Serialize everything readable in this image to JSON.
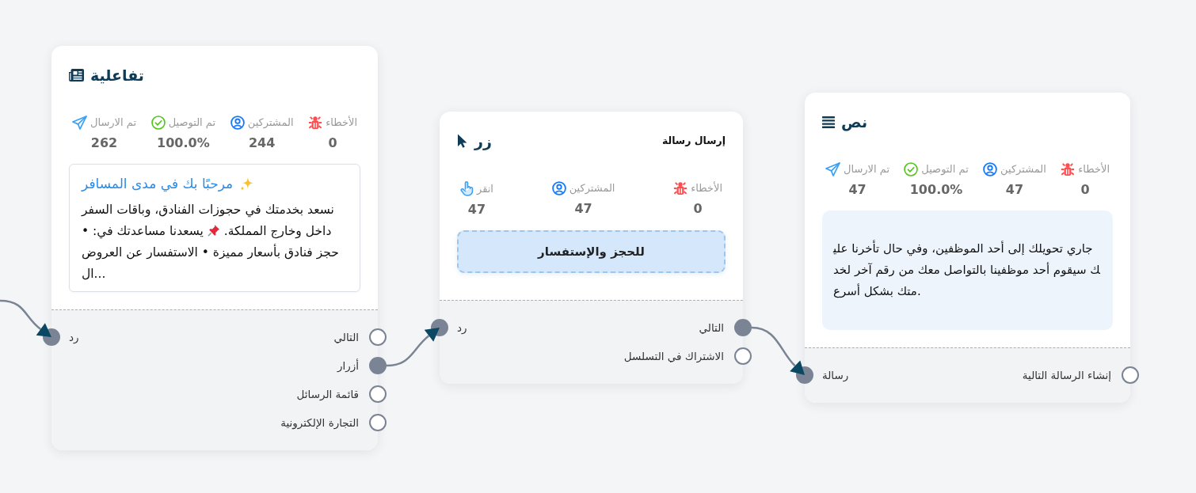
{
  "nodes": [
    {
      "kind": "text",
      "title": "نص",
      "stats": [
        {
          "kind": "errors",
          "label": "الأخطاء",
          "value": "0"
        },
        {
          "kind": "subscribers",
          "label": "المشتركين",
          "value": "47"
        },
        {
          "kind": "delivered",
          "label": "تم التوصيل",
          "value": "100.0%"
        },
        {
          "kind": "sent",
          "label": "تم الارسال",
          "value": "47"
        }
      ],
      "text": "جاري تحويلك إلى أحد الموظفين، وفي حال تأخرنا عليك سيقوم أحد موظفينا بالتواصل معك من رقم آخر لخدمتك بشكل أسرع.",
      "outputs": [
        {
          "label": "إنشاء الرسالة التالية",
          "connected": false
        }
      ],
      "inputs": [
        {
          "label": "رسالة",
          "connected": true
        }
      ]
    },
    {
      "kind": "button",
      "title": "زر",
      "subtitle": "إرسال رسالة",
      "stats": [
        {
          "kind": "errors",
          "label": "الأخطاء",
          "value": "0"
        },
        {
          "kind": "subscribers",
          "label": "المشتركين",
          "value": "47"
        },
        {
          "kind": "clicks",
          "label": "انقر",
          "value": "47"
        }
      ],
      "button": {
        "label": "للحجز والإستفسار"
      },
      "outputs": [
        {
          "label": "التالي",
          "connected": true
        },
        {
          "label": "الاشتراك في التسلسل",
          "connected": false
        }
      ],
      "inputs": [
        {
          "label": "رد",
          "connected": true
        }
      ]
    },
    {
      "kind": "interactive",
      "title": "تفاعلية",
      "stats": [
        {
          "kind": "errors",
          "label": "الأخطاء",
          "value": "0"
        },
        {
          "kind": "subscribers",
          "label": "المشتركين",
          "value": "244"
        },
        {
          "kind": "delivered",
          "label": "تم التوصيل",
          "value": "100.0%"
        },
        {
          "kind": "sent",
          "label": "تم الارسال",
          "value": "262"
        }
      ],
      "message": {
        "title": "مرحبًا بك في مدى المسافر",
        "body": [
          "نسعد بخدمتك في حجوزات الفنادق، وباقات السفر داخل وخارج المملكة.",
          "يسعدنا مساعدتك في: • حجز فنادق بأسعار مميزة • الاستفسار عن العروض ال..."
        ]
      },
      "outputs": [
        {
          "label": "التالي",
          "connected": false
        },
        {
          "label": "أزرار",
          "connected": true
        },
        {
          "label": "قائمة الرسائل",
          "connected": false
        },
        {
          "label": "التجارة الإلكترونية",
          "connected": false
        }
      ],
      "inputs": [
        {
          "label": "رد",
          "connected": true
        }
      ]
    }
  ]
}
